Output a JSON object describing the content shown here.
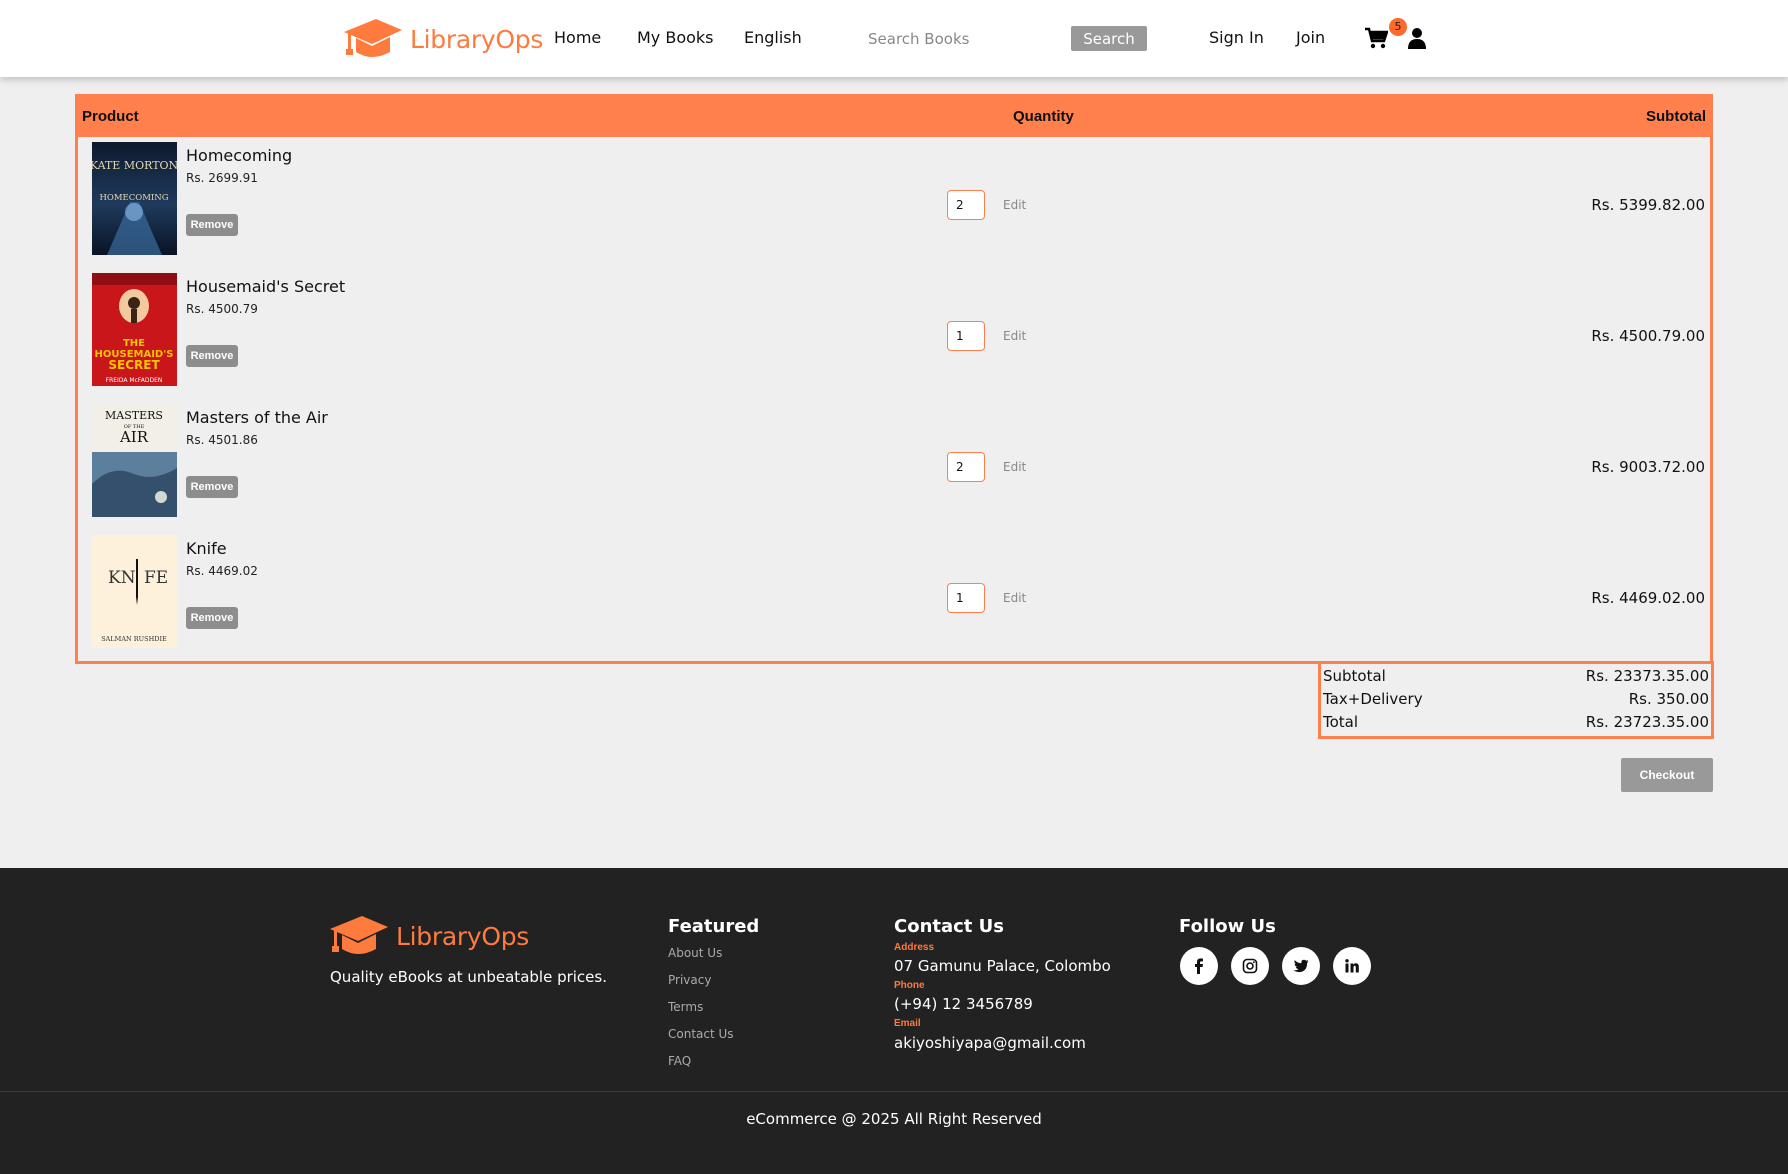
{
  "header": {
    "brand": "LibraryOps",
    "nav": [
      "Home",
      "My Books",
      "English"
    ],
    "search_placeholder": "Search Books",
    "search_button": "Search",
    "sign_in": "Sign In",
    "join": "Join",
    "cart_count": "5",
    "cart_icon": "shopping-cart-icon",
    "user_icon": "user-icon"
  },
  "cart": {
    "headers": {
      "product": "Product",
      "quantity": "Quantity",
      "subtotal": "Subtotal"
    },
    "items": [
      {
        "name": "Homecoming",
        "price": "Rs. 2699.91",
        "remove": "Remove",
        "qty": "2",
        "edit": "Edit",
        "subtotal": "Rs. 5399.82.00",
        "cover_author": "KATE MORTON",
        "cover_title": "HOMECOMING"
      },
      {
        "name": "Housemaid's Secret",
        "price": "Rs. 4500.79",
        "remove": "Remove",
        "qty": "1",
        "edit": "Edit",
        "subtotal": "Rs. 4500.79.00",
        "cover_author": "FREIDA McFADDEN",
        "cover_title": "THE HOUSEMAID'S SECRET"
      },
      {
        "name": "Masters of the Air",
        "price": "Rs. 4501.86",
        "remove": "Remove",
        "qty": "2",
        "edit": "Edit",
        "subtotal": "Rs. 9003.72.00",
        "cover_author": "",
        "cover_title": "MASTERS OF THE AIR"
      },
      {
        "name": "Knife",
        "price": "Rs. 4469.02",
        "remove": "Remove",
        "qty": "1",
        "edit": "Edit",
        "subtotal": "Rs. 4469.02.00",
        "cover_author": "SALMAN RUSHDIE",
        "cover_title": "KNIFE"
      }
    ]
  },
  "totals": {
    "subtotal_label": "Subtotal",
    "subtotal": "Rs. 23373.35.00",
    "tax_label": "Tax+Delivery",
    "tax": "Rs. 350.00",
    "total_label": "Total",
    "total": "Rs. 23723.35.00"
  },
  "checkout": "Checkout",
  "footer": {
    "brand": "LibraryOps",
    "tagline": "Quality eBooks at unbeatable prices.",
    "featured_heading": "Featured",
    "featured_links": [
      "About Us",
      "Privacy",
      "Terms",
      "Contact Us",
      "FAQ"
    ],
    "contact_heading": "Contact Us",
    "address_label": "Address",
    "address": "07 Gamunu Palace, Colombo",
    "phone_label": "Phone",
    "phone": "(+94) 12 3456789",
    "email_label": "Email",
    "email": "akiyoshiyapa@gmail.com",
    "follow_heading": "Follow Us",
    "social_icons": [
      "facebook-icon",
      "instagram-icon",
      "twitter-icon",
      "linkedin-icon"
    ],
    "copyright": "eCommerce @ 2025 All Right Reserved"
  },
  "colors": {
    "accent": "#ff7f4d",
    "footer_bg": "#222222",
    "button_gray": "#999999"
  }
}
